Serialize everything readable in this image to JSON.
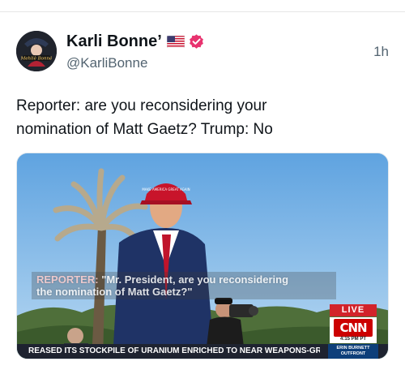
{
  "post": {
    "author_name": "Karli Bonne’",
    "handle": "@KarliBonne",
    "time": "1h",
    "text": "Reporter: are you reconsidering your\nnomination of Matt Gaetz? Trump: No",
    "avatar_text": "Mehliè Bonné",
    "icons": {
      "flag": "us-flag-icon",
      "verified": "verified-badge-icon"
    },
    "colors": {
      "verified": "#e8336f",
      "secondary_text": "#536471"
    }
  },
  "media": {
    "caption": {
      "speaker": "REPORTER:",
      "line1": "\"Mr. President, are you reconsidering",
      "line2": "the nomination of Matt Gaetz?\""
    },
    "hat_text": "MAKE AMERICA GREAT AGAIN",
    "live_label": "LIVE",
    "network_logo": "CNN",
    "network_time": "4:15 PM PT",
    "ticker_text": "REASED ITS STOCKPILE OF URANIUM ENRICHED TO NEAR WEAPONS-GRADE LEVELS, A",
    "show_name": "ERIN BURNETT OUTFRONT"
  }
}
